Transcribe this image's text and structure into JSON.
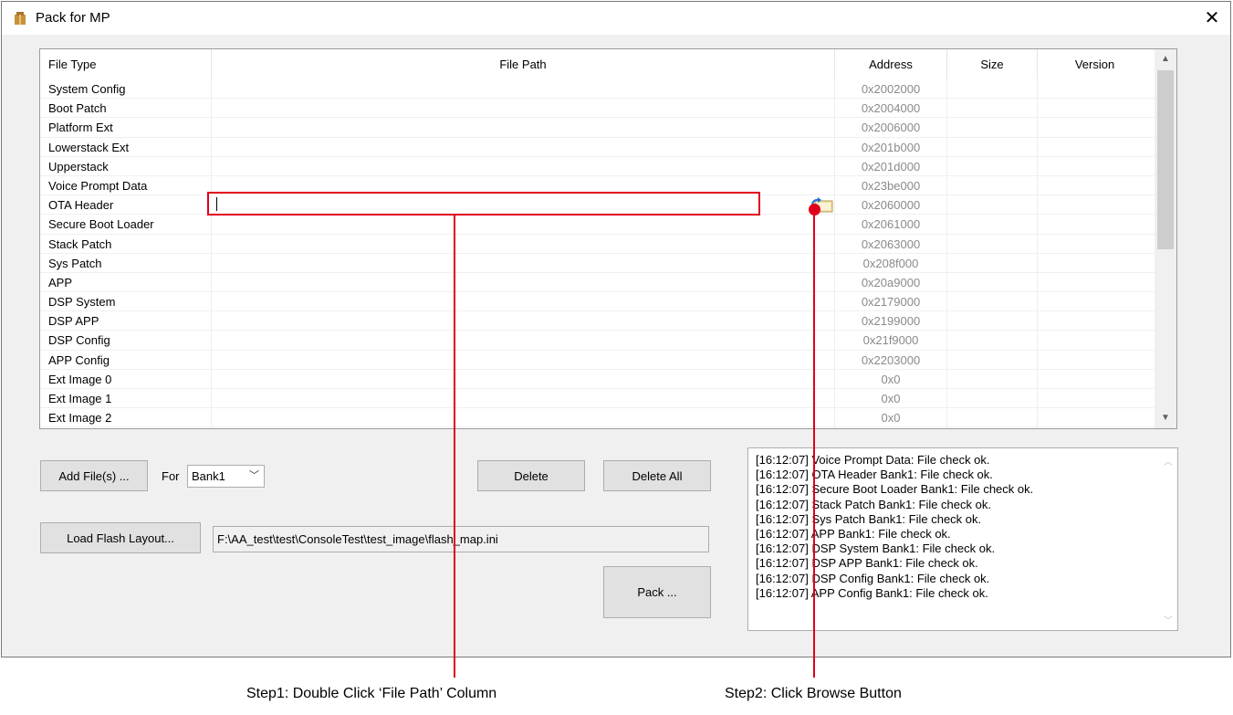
{
  "window": {
    "title": "Pack for MP",
    "close": "✕"
  },
  "table": {
    "headers": [
      "File Type",
      "File Path",
      "Address",
      "Size",
      "Version"
    ],
    "rows": [
      {
        "type": "System Config",
        "address": "0x2002000"
      },
      {
        "type": "Boot Patch",
        "address": "0x2004000"
      },
      {
        "type": "Platform Ext",
        "address": "0x2006000"
      },
      {
        "type": "Lowerstack Ext",
        "address": "0x201b000"
      },
      {
        "type": "Upperstack",
        "address": "0x201d000"
      },
      {
        "type": "Voice Prompt Data",
        "address": "0x23be000"
      },
      {
        "type": "OTA Header",
        "address": "0x2060000"
      },
      {
        "type": "Secure Boot Loader",
        "address": "0x2061000"
      },
      {
        "type": "Stack Patch",
        "address": "0x2063000"
      },
      {
        "type": "Sys Patch",
        "address": "0x208f000"
      },
      {
        "type": "APP",
        "address": "0x20a9000"
      },
      {
        "type": "DSP System",
        "address": "0x2179000"
      },
      {
        "type": "DSP APP",
        "address": "0x2199000"
      },
      {
        "type": "DSP Config",
        "address": "0x21f9000"
      },
      {
        "type": "APP Config",
        "address": "0x2203000"
      },
      {
        "type": "Ext Image 0",
        "address": "0x0"
      },
      {
        "type": "Ext Image 1",
        "address": "0x0"
      },
      {
        "type": "Ext Image 2",
        "address": "0x0"
      }
    ]
  },
  "controls": {
    "add_files": "Add File(s) ...",
    "for_label": "For",
    "bank_selected": "Bank1",
    "delete": "Delete",
    "delete_all": "Delete All",
    "load_flash_layout": "Load Flash Layout...",
    "flash_map_path": "F:\\AA_test\\test\\ConsoleTest\\test_image\\flash_map.ini",
    "pack": "Pack ..."
  },
  "log": [
    "[16:12:07] Voice Prompt Data: File check ok.",
    "[16:12:07] OTA Header Bank1: File check ok.",
    "[16:12:07] Secure Boot Loader Bank1: File check ok.",
    "[16:12:07] Stack Patch Bank1: File check ok.",
    "[16:12:07] Sys Patch Bank1: File check ok.",
    "[16:12:07] APP Bank1: File check ok.",
    "[16:12:07] DSP System Bank1: File check ok.",
    "[16:12:07] DSP APP Bank1: File check ok.",
    "[16:12:07] DSP Config Bank1: File check ok.",
    "[16:12:07] APP Config Bank1: File check ok."
  ],
  "annotations": {
    "step1": "Step1: Double Click ‘File Path’ Column",
    "step2": "Step2: Click Browse Button",
    "color": "#e0001b"
  }
}
